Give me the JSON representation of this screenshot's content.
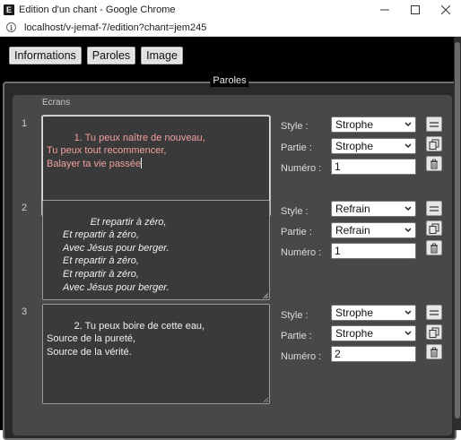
{
  "window": {
    "title": "Edition d'un chant - Google Chrome",
    "app_icon_letter": "E"
  },
  "address": {
    "url": "localhost/v-jemaf-7/edition?chant=jem245"
  },
  "tabs": [
    {
      "label": "Informations"
    },
    {
      "label": "Paroles"
    },
    {
      "label": "Image"
    }
  ],
  "section": {
    "legend": "Paroles",
    "screens_label": "Ecrans"
  },
  "fields": {
    "style_label": "Style :",
    "partie_label": "Partie :",
    "numero_label": "Numéro :"
  },
  "ecrans": [
    {
      "index": "1",
      "text": "1. Tu peux naître de nouveau,\nTu peux tout recommencer,\nBalayer ta vie passée",
      "style": "Strophe",
      "partie": "Strophe",
      "numero": "1"
    },
    {
      "index": "2",
      "text": "Et repartir à zéro,\nEt repartir à zéro,\nAvec Jésus pour berger.\nEt repartir à zéro,\nEt repartir à zéro,\nAvec Jésus pour berger.",
      "style": "Refrain",
      "partie": "Refrain",
      "numero": "1"
    },
    {
      "index": "3",
      "text": "2. Tu peux boire de cette eau,\nSource de la pureté,\nSource de la vérité.",
      "style": "Strophe",
      "partie": "Strophe",
      "numero": "2"
    }
  ],
  "icons": [
    "app-icon",
    "minimize-icon",
    "maximize-icon",
    "close-icon",
    "info-icon",
    "chevron-down-icon",
    "drag-handle-icon",
    "copy-icon",
    "trash-icon"
  ]
}
